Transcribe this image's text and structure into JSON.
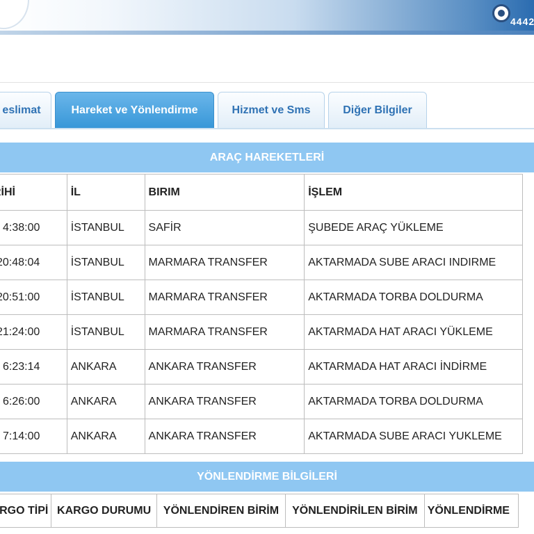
{
  "header": {
    "hotline": "4442"
  },
  "tabs": [
    {
      "label": "eslimat"
    },
    {
      "label": "Hareket ve Yönlendirme",
      "active": true
    },
    {
      "label": "Hizmet ve Sms"
    },
    {
      "label": "Diğer Bilgiler"
    }
  ],
  "arac": {
    "title": "ARAÇ HAREKETLERİ",
    "headers": [
      "RİHİ",
      "İL",
      "BIRIM",
      "İŞLEM"
    ],
    "rows": [
      [
        "4:38:00",
        "İSTANBUL",
        "SAFİR",
        "ŞUBEDE ARAÇ YÜKLEME"
      ],
      [
        "20:48:04",
        "İSTANBUL",
        "MARMARA TRANSFER",
        "AKTARMADA SUBE ARACI INDIRME"
      ],
      [
        "20:51:00",
        "İSTANBUL",
        "MARMARA TRANSFER",
        "AKTARMADA TORBA DOLDURMA"
      ],
      [
        "21:24:00",
        "İSTANBUL",
        "MARMARA TRANSFER",
        "AKTARMADA HAT ARACI YÜKLEME"
      ],
      [
        "6:23:14",
        "ANKARA",
        "ANKARA TRANSFER",
        "AKTARMADA HAT ARACI İNDİRME"
      ],
      [
        "6:26:00",
        "ANKARA",
        "ANKARA TRANSFER",
        "AKTARMADA TORBA DOLDURMA"
      ],
      [
        "7:14:00",
        "ANKARA",
        "ANKARA TRANSFER",
        "AKTARMADA SUBE ARACI YUKLEME"
      ]
    ]
  },
  "yonlendirme": {
    "title": "YÖNLENDİRME BİLGİLERİ",
    "headers": [
      "RGO TİPİ",
      "KARGO DURUMU",
      "YÖNLENDİREN BİRİM",
      "YÖNLENDİRİLEN BİRİM",
      "YÖNLENDİRME"
    ]
  }
}
